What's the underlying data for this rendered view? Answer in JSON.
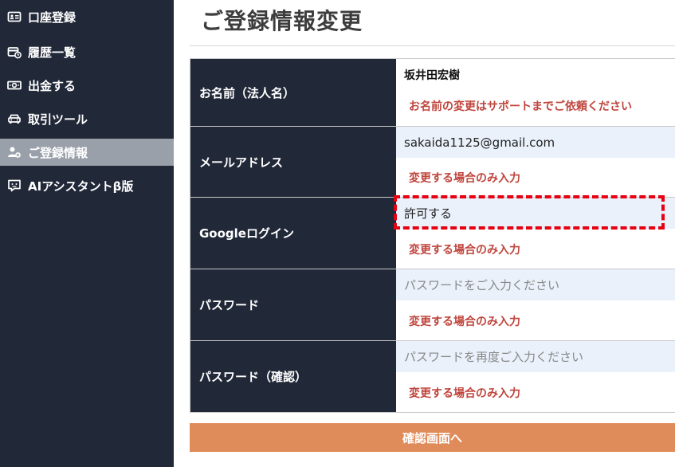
{
  "sidebar": {
    "items": [
      {
        "label": "口座登録",
        "icon": "id-card-icon",
        "active": false
      },
      {
        "label": "履歴一覧",
        "icon": "history-card-icon",
        "active": false
      },
      {
        "label": "出金する",
        "icon": "money-icon",
        "active": false
      },
      {
        "label": "取引ツール",
        "icon": "car-icon",
        "active": false
      },
      {
        "label": "ご登録情報",
        "icon": "user-gear-icon",
        "active": true
      },
      {
        "label": "AIアシスタントβ版",
        "icon": "chat-bot-icon",
        "active": false
      }
    ]
  },
  "page": {
    "title": "ご登録情報変更"
  },
  "form": {
    "rows": [
      {
        "label": "お名前（法人名）",
        "value": "坂井田宏樹",
        "note": "お名前の変更はサポートまでご依頼ください"
      },
      {
        "label": "メールアドレス",
        "value": "sakaida1125@gmail.com",
        "note": "変更する場合のみ入力"
      },
      {
        "label": "Googleログイン",
        "value": "許可する",
        "note": "変更する場合のみ入力"
      },
      {
        "label": "パスワード",
        "placeholder": "パスワードをご入力ください",
        "note": "変更する場合のみ入力"
      },
      {
        "label": "パスワード（確認）",
        "placeholder": "パスワードを再度ご入力ください",
        "note": "変更する場合のみ入力"
      }
    ]
  },
  "actions": {
    "confirm_label": "確認画面へ"
  },
  "colors": {
    "sidebar_bg": "#212838",
    "active_item_bg": "#9aa0aa",
    "note_red": "#c0453d",
    "button_orange": "#e08b5a",
    "highlight_red": "#e60012"
  }
}
